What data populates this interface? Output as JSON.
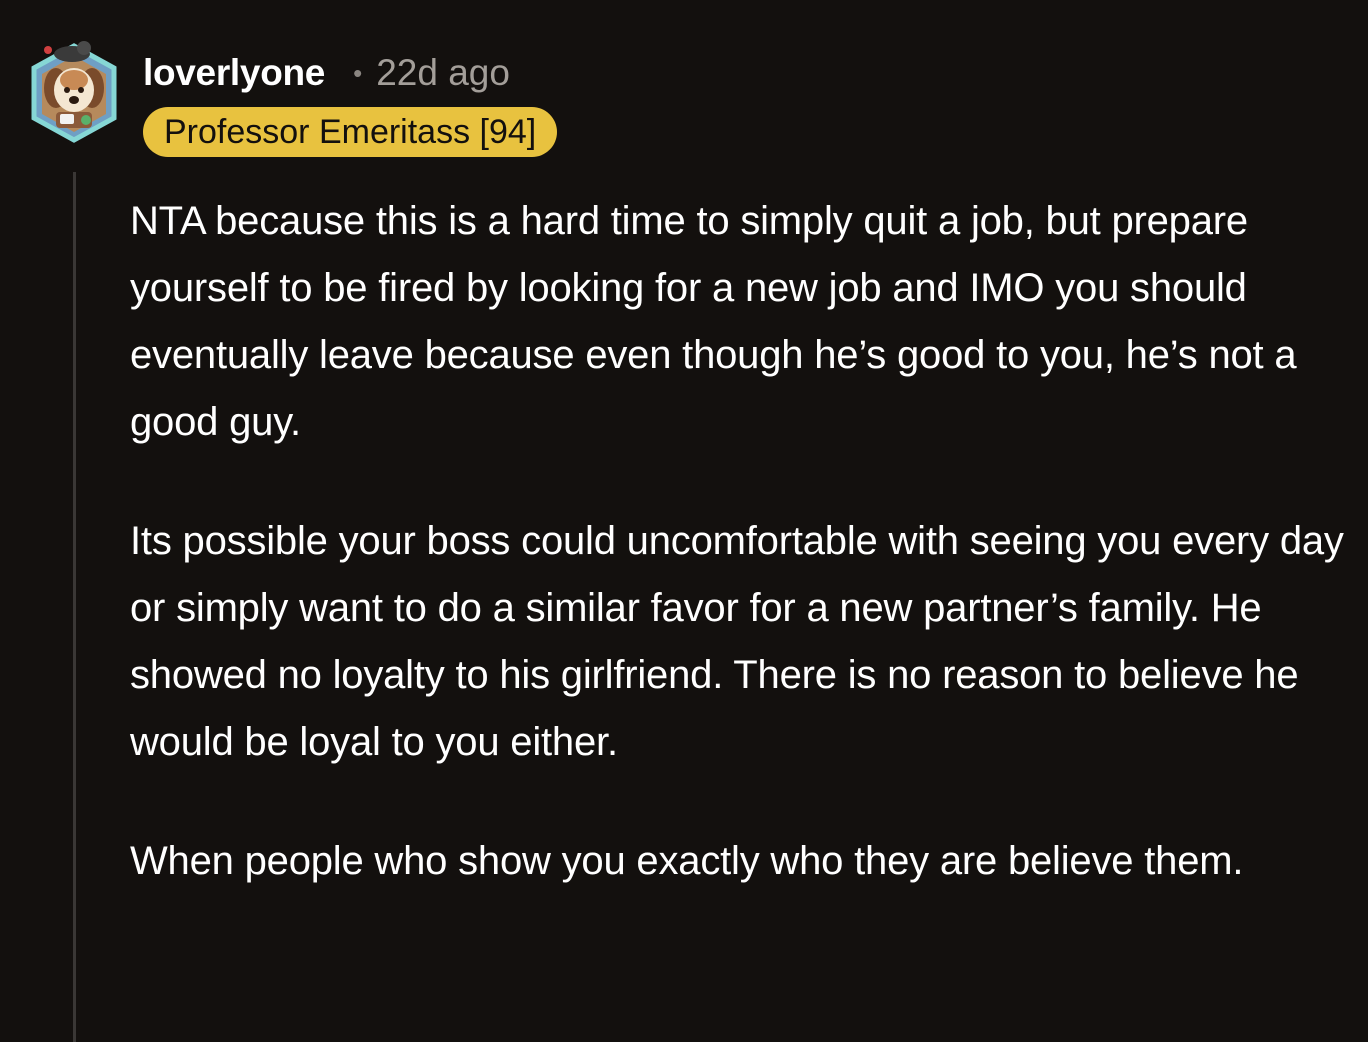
{
  "comment": {
    "author": "loverlyone",
    "separator": "•",
    "timestamp": "22d ago",
    "flair": "Professor Emeritass [94]",
    "avatar_icon": "dog-avatar-icon",
    "paragraphs": [
      "NTA because this is a hard time to simply quit a job, but prepare yourself to be fired by looking for a new job and IMO you should eventually leave because even though he’s good to you, he’s not a good guy.",
      "Its possible your boss could uncomfortable with seeing you every day or simply want to do a similar favor for a new partner’s family. He showed no loyalty to his girlfriend. There is no reason to believe he would be loyal to you either.",
      "When people who show you exactly who they are believe them."
    ]
  },
  "colors": {
    "background": "#13100e",
    "flair_bg": "#e8c23f",
    "thread_line": "#3a3735",
    "meta_text": "#a39e99"
  }
}
